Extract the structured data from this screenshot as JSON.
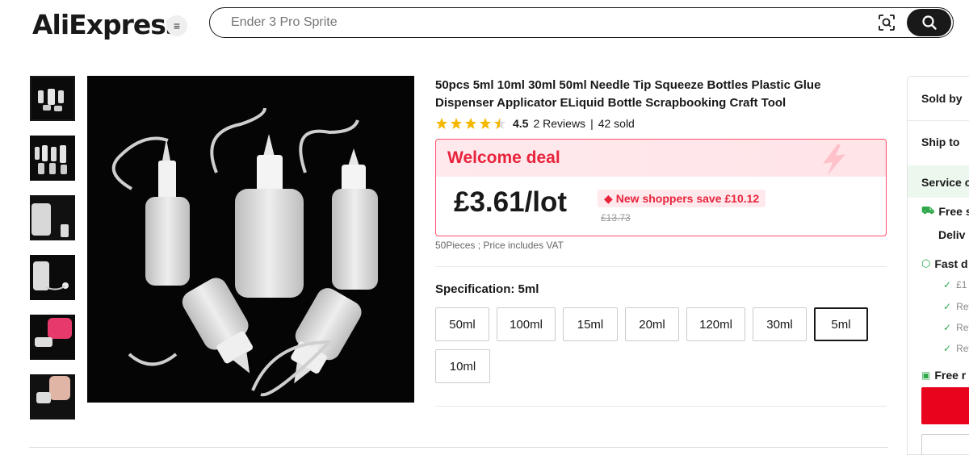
{
  "header": {
    "logo": "AliExpress",
    "search_placeholder": "Ender 3 Pro Sprite"
  },
  "product": {
    "title": "50pcs 5ml 10ml 30ml 50ml Needle Tip Squeeze Bottles Plastic Glue Dispenser Applicator ELiquid Bottle Scrapbooking Craft Tool",
    "rating": "4.5",
    "rating_stars": 4.5,
    "reviews": "2 Reviews",
    "sold": "42 sold",
    "deal_title": "Welcome deal",
    "price": "£3.61/lot",
    "save_text": "New shoppers save  £10.12",
    "old_price": "£13.73",
    "vat_note": "50Pieces ; Price includes VAT",
    "spec_label": "Specification: 5ml",
    "spec_options": [
      "50ml",
      "100ml",
      "15ml",
      "20ml",
      "120ml",
      "30ml",
      "5ml",
      "10ml"
    ],
    "selected_option": "5ml"
  },
  "sidebar": {
    "sold_by": "Sold by",
    "ship_to": "Ship to",
    "service": "Service c",
    "free_ship": "Free s",
    "delivery": "Deliv",
    "fast": "Fast d",
    "fast_items": [
      "£1",
      "Ref",
      "Ref",
      "Ref"
    ],
    "free_more": "Free r"
  },
  "colors": {
    "accent_red": "#e8243c",
    "buy_red": "#e8041c",
    "star": "#f5b800",
    "service_green": "#2ea84a"
  }
}
